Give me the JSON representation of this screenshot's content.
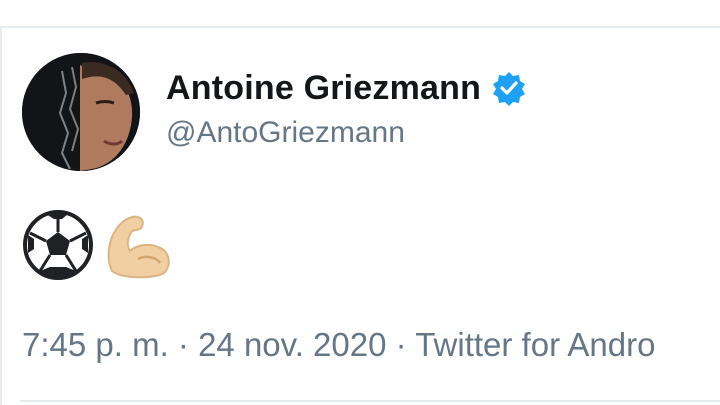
{
  "tweet": {
    "author": {
      "display_name": "Antoine Griezmann",
      "handle": "@AntoGriezmann",
      "verified": true,
      "avatar_icon": "profile-photo"
    },
    "body": {
      "emojis": [
        "soccer-ball-icon",
        "flexed-biceps-icon"
      ]
    },
    "meta": {
      "time": "7:45 p. m.",
      "separator": " · ",
      "date": "24 nov. 2020",
      "source": "Twitter for Andro"
    }
  },
  "colors": {
    "text_primary": "#14171a",
    "text_secondary": "#657786",
    "verified_blue": "#1da1f2",
    "divider": "#e6ecf0"
  }
}
